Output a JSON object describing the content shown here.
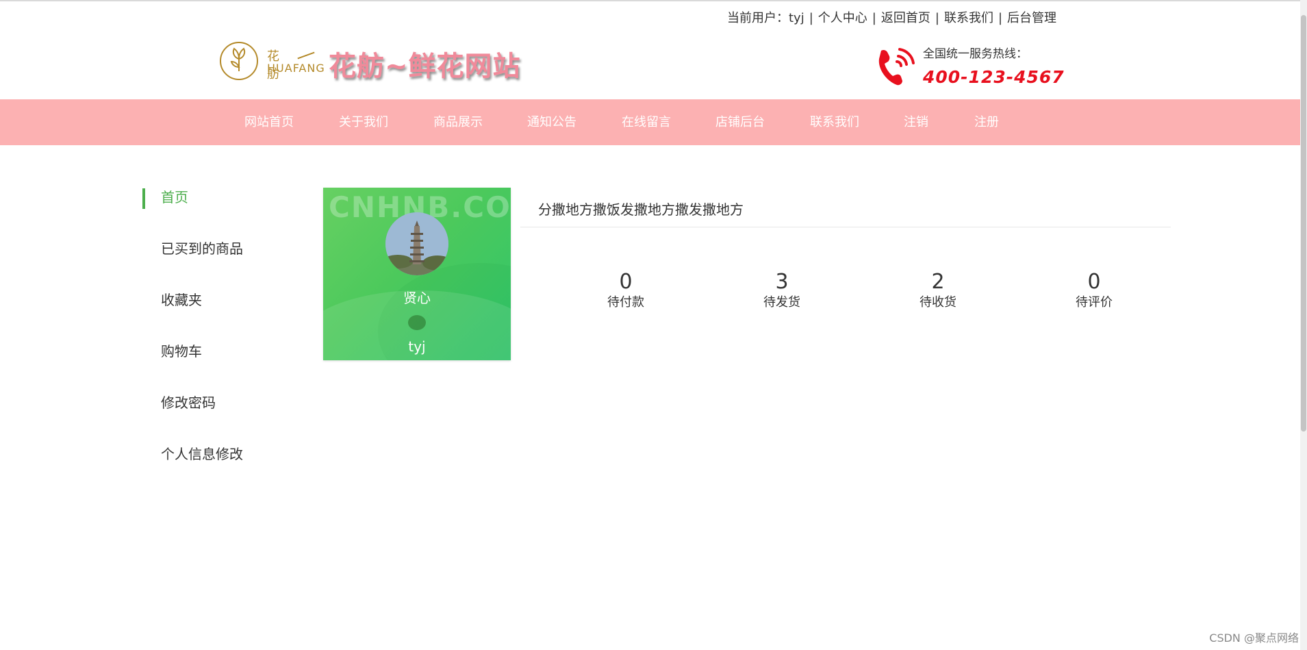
{
  "topbar": {
    "current_user_label": "当前用户：tyj",
    "links": [
      "个人中心",
      "返回首页",
      "联系我们",
      "后台管理"
    ],
    "separator": "|"
  },
  "logo": {
    "cn": "花舫",
    "en": "HUAFANG",
    "site_title": "花舫~鲜花网站"
  },
  "hotline": {
    "label": "全国统一服务热线：",
    "number": "400-123-4567"
  },
  "nav": {
    "items": [
      "网站首页",
      "关于我们",
      "商品展示",
      "通知公告",
      "在线留言",
      "店铺后台",
      "联系我们",
      "注销",
      "注册"
    ]
  },
  "sidebar": {
    "items": [
      "首页",
      "已买到的商品",
      "收藏夹",
      "购物车",
      "修改密码",
      "个人信息修改"
    ],
    "active_index": 0
  },
  "user_card": {
    "watermark": "CNHNB.COM",
    "display_name": "贤心",
    "username": "tyj"
  },
  "main": {
    "notice": "分撒地方撒饭发撒地方撒发撒地方",
    "stats": [
      {
        "value": "0",
        "label": "待付款"
      },
      {
        "value": "3",
        "label": "待发货"
      },
      {
        "value": "2",
        "label": "待收货"
      },
      {
        "value": "0",
        "label": "待评价"
      }
    ]
  },
  "footer_watermark": "CSDN @聚点网络",
  "colors": {
    "nav_bg": "#fcb1b2",
    "accent_green": "#4cae4c",
    "hotline_red": "#e8101e",
    "title_pink": "#f08a9a"
  }
}
